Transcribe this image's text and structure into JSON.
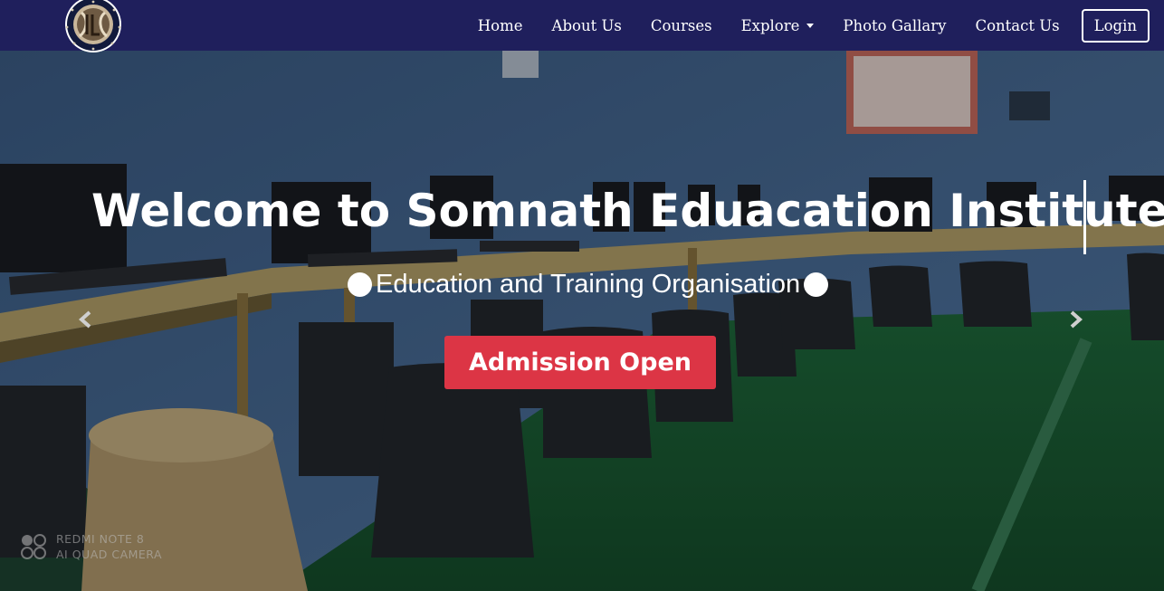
{
  "navbar": {
    "items": [
      {
        "label": "Home"
      },
      {
        "label": "About Us"
      },
      {
        "label": "Courses"
      },
      {
        "label": "Explore"
      },
      {
        "label": "Photo Gallary"
      },
      {
        "label": "Contact Us"
      }
    ],
    "login_label": "Login"
  },
  "hero": {
    "title": "Welcome to Somnath Eduacation Institute",
    "subtitle": "Education and Training Organisation",
    "cta_label": "Admission Open",
    "prev_icon": "chevron-left-icon",
    "next_icon": "chevron-right-icon"
  },
  "watermark": {
    "line1": "REDMI NOTE 8",
    "line2": "AI QUAD CAMERA"
  },
  "colors": {
    "navbar_bg": "#1f1f5c",
    "cta_bg": "#dc3545",
    "text": "#ffffff"
  }
}
